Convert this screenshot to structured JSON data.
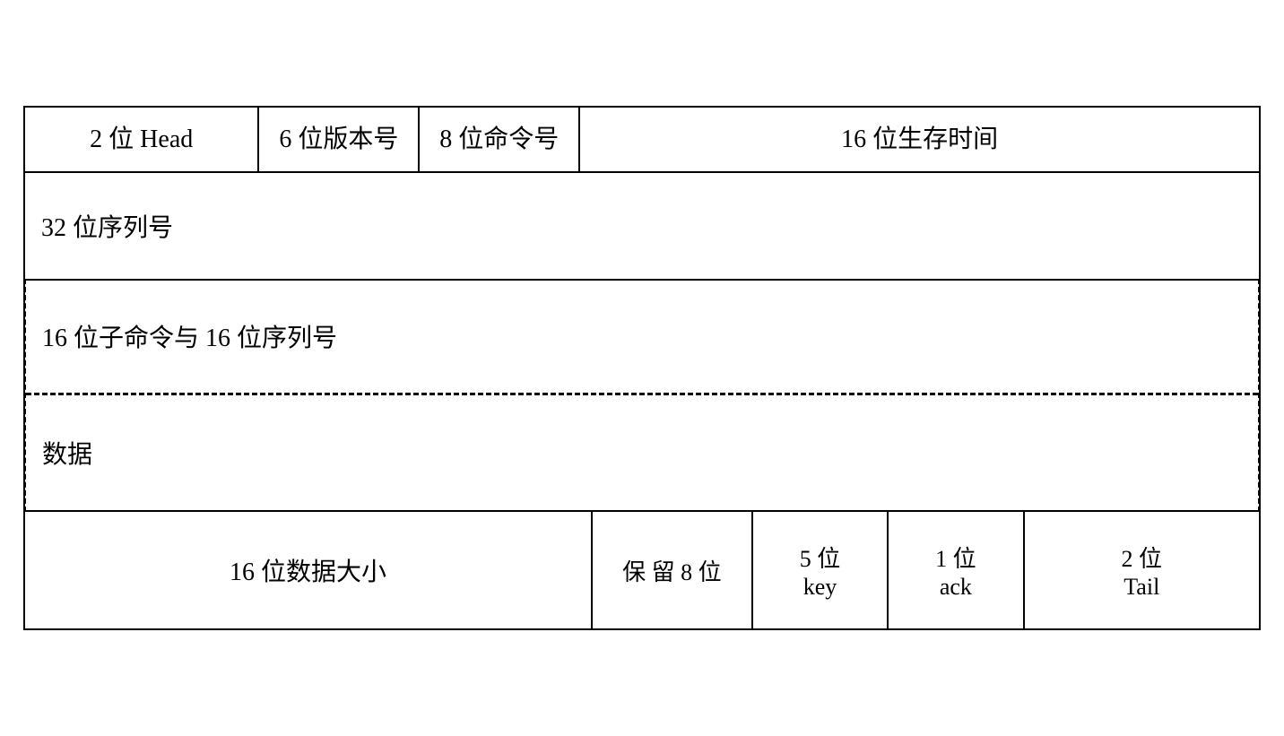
{
  "diagram": {
    "row1": {
      "cell_head": "2 位 Head",
      "cell_version": "6 位版本号",
      "cell_cmd": "8 位命令号",
      "cell_ttl": "16 位生存时间"
    },
    "row2": {
      "text": "32 位序列号"
    },
    "row3": {
      "text": "16 位子命令与 16 位序列号"
    },
    "row4": {
      "text": "数据"
    },
    "row5": {
      "cell_datasize": "16 位数据大小",
      "cell_reserved": "保 留 8 位",
      "cell_key": "5 位\nkey",
      "cell_ack": "1 位\nack",
      "cell_tail": "2 位\nTail"
    }
  }
}
